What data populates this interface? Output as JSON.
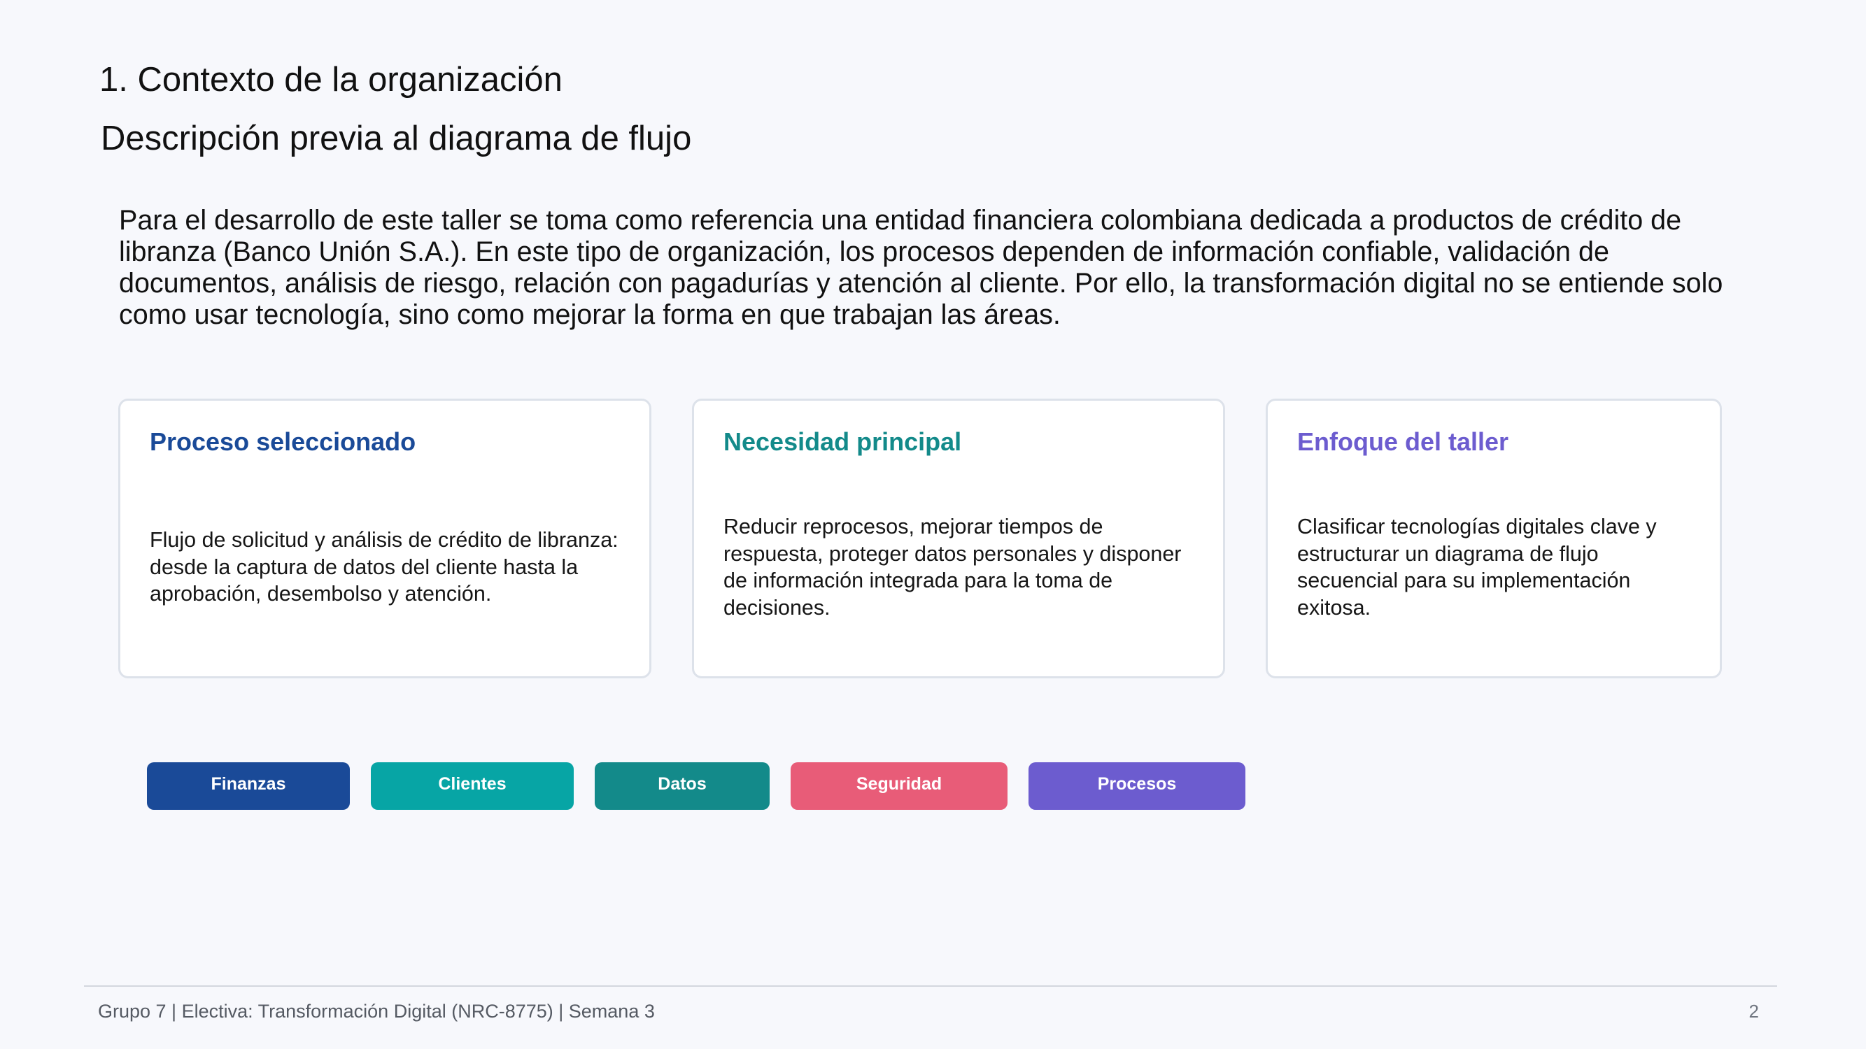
{
  "header": {
    "title": "1. Contexto de la organización",
    "subtitle": "Descripción previa al diagrama de flujo"
  },
  "intro": "Para el desarrollo de este taller se toma como referencia una entidad financiera colombiana dedicada a productos de crédito de libranza (Banco Unión S.A.). En este tipo de organización, los procesos dependen de información confiable, validación de documentos, análisis de riesgo, relación con pagadurías y atención al cliente. Por ello, la transformación digital no se entiende solo como usar tecnología, sino como mejorar la forma en que trabajan las áreas.",
  "cards": [
    {
      "title": "Proceso seleccionado",
      "title_color": "#1a4a98",
      "body": "Flujo de solicitud y análisis de crédito de libranza: desde la captura de datos del cliente hasta la aprobación, desembolso y atención."
    },
    {
      "title": "Necesidad principal",
      "title_color": "#138a8a",
      "body": "Reducir reprocesos, mejorar tiempos de respuesta, proteger datos personales y disponer de información integrada para la toma de decisiones."
    },
    {
      "title": "Enfoque del taller",
      "title_color": "#6c5ccf",
      "body": "Clasificar tecnologías digitales clave y estructurar un diagrama de flujo secuencial para su implementación exitosa."
    }
  ],
  "tags": [
    {
      "label": "Finanzas",
      "color": "#1a4a98"
    },
    {
      "label": "Clientes",
      "color": "#07a5a5"
    },
    {
      "label": "Datos",
      "color": "#138a8a"
    },
    {
      "label": "Seguridad",
      "color": "#e85c78"
    },
    {
      "label": "Procesos",
      "color": "#6c5ccf"
    }
  ],
  "footer": {
    "text": "Grupo 7 | Electiva: Transformación Digital (NRC-8775) | Semana 3",
    "page_number": "2"
  }
}
